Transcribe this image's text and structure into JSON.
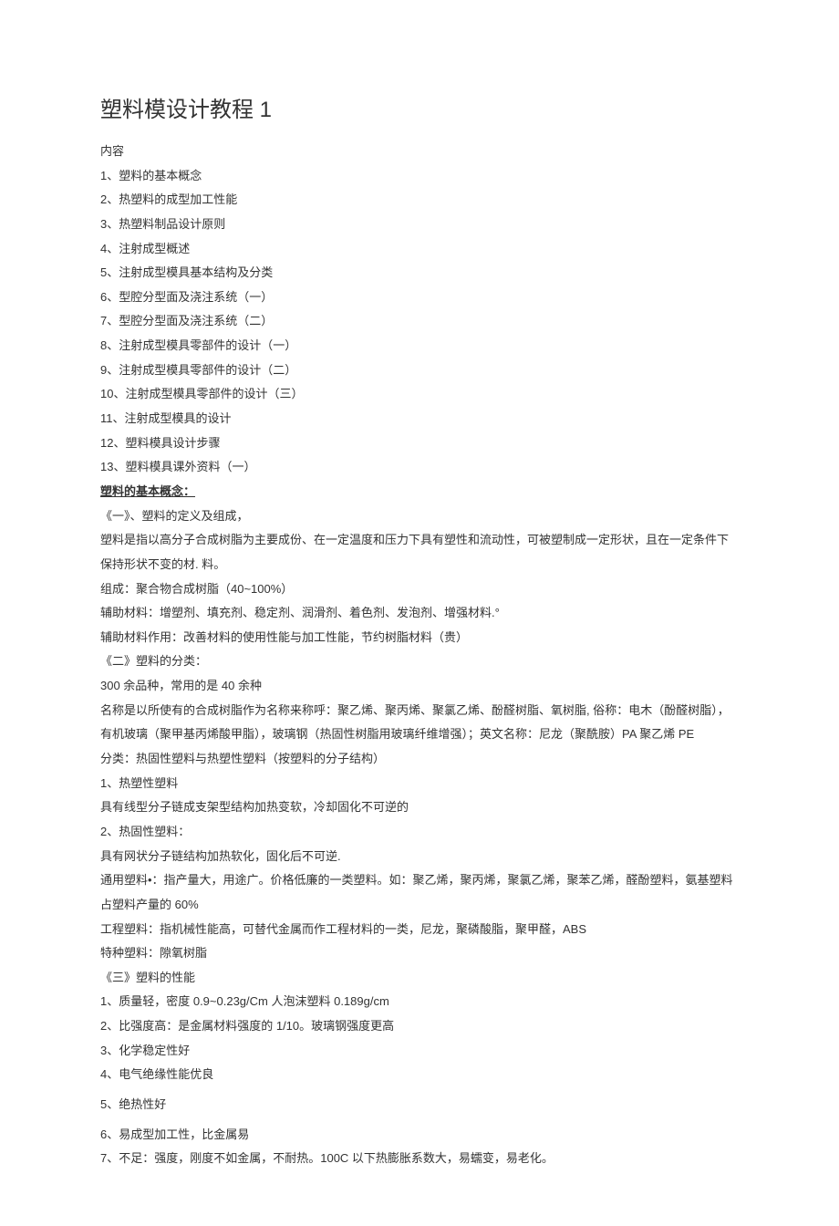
{
  "title": "塑料模设计教程 1",
  "header": "内容",
  "toc": [
    "1、塑料的基本概念",
    "2、热塑料的成型加工性能",
    "3、热塑料制品设计原则",
    "4、注射成型概述",
    "5、注射成型模具基本结构及分类",
    "6、型腔分型面及浇注系统（一）",
    "7、型腔分型面及浇注系统（二）",
    "8、注射成型模具零部件的设计（一）",
    "9、注射成型模具零部件的设计（二）",
    "10、注射成型模具零部件的设计（三）",
    "11、注射成型模具的设计",
    "12、塑料模具设计步骤",
    "13、塑料模具课外资料（一）"
  ],
  "section_title": "塑料的基本概念：",
  "body": [
    "《一》、塑料的定义及组成，",
    "塑料是指以高分子合成树脂为主要成份、在一定温度和压力下具有塑性和流动性，可被塑制成一定形状，且在一定条件下保持形状不变的材. 料。",
    "组成：聚合物合成树脂（40~100%）",
    "辅助材料：增塑剂、填充剂、稳定剂、润滑剂、着色剂、发泡剂、增强材料.°",
    "辅助材料作用：改善材料的使用性能与加工性能，节约树脂材料（贵）",
    "《二》塑料的分类：",
    "300 余品种，常用的是 40 余种",
    "名称是以所使有的合成树脂作为名称来称呼：聚乙烯、聚丙烯、聚氯乙烯、酚醛树脂、氧树脂, 俗称：电木（酚醛树脂），有机玻璃（聚甲基丙烯酸甲脂），玻璃钢（热固性树脂用玻璃纤维增强）；英文名称：尼龙（聚酰胺）PA 聚乙烯 PE",
    "分类：热固性塑料与热塑性塑料（按塑料的分子结构）",
    "1、热塑性塑料",
    "具有线型分子链成支架型结构加热变软，冷却固化不可逆的",
    "2、热固性塑料：",
    "具有网状分子链结构加热软化，固化后不可逆.",
    "通用塑料•：指产量大，用途广。价格低廉的一类塑料。如：聚乙烯，聚丙烯，聚氯乙烯，聚苯乙烯，醛酚塑料，氨基塑料占塑料产量的 60%",
    "工程塑料：指机械性能高，可替代金属而作工程材料的一类，尼龙，聚磷酸脂，聚甲醛，ABS",
    "特种塑料：隙氧树脂",
    "《三》塑料的性能",
    "1、质量轻，密度 0.9~0.23g/Cm 人泡沫塑料 0.189g/cm",
    "2、比强度高：是金属材料强度的 1/10。玻璃钢强度更高",
    "3、化学稳定性好",
    "4、电气绝缘性能优良",
    "5、绝热性好",
    "6、易成型加工性，比金属易",
    "7、不足：强度，刚度不如金属，不耐热。100C 以下热膨胀系数大，易蠕变，易老化。"
  ]
}
